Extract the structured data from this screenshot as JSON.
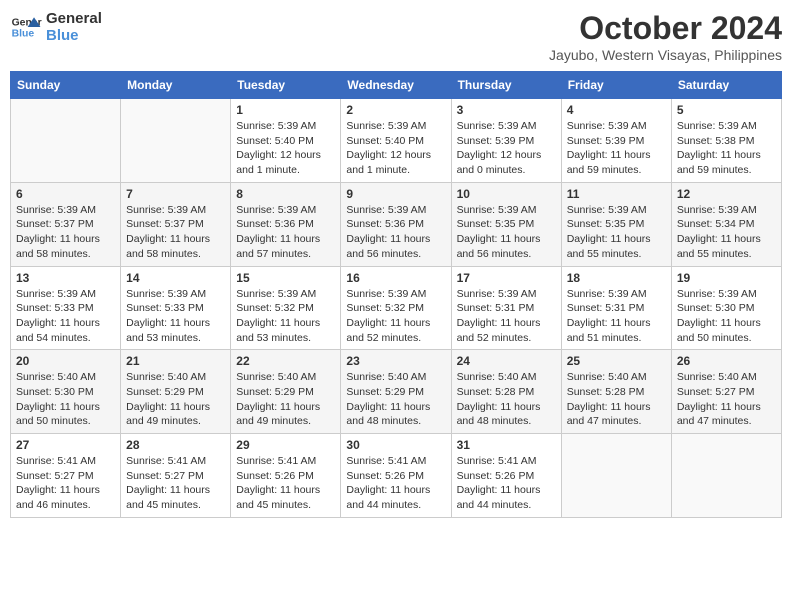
{
  "logo": {
    "line1": "General",
    "line2": "Blue"
  },
  "title": "October 2024",
  "location": "Jayubo, Western Visayas, Philippines",
  "days_header": [
    "Sunday",
    "Monday",
    "Tuesday",
    "Wednesday",
    "Thursday",
    "Friday",
    "Saturday"
  ],
  "weeks": [
    [
      {
        "day": "",
        "info": ""
      },
      {
        "day": "",
        "info": ""
      },
      {
        "day": "1",
        "info": "Sunrise: 5:39 AM\nSunset: 5:40 PM\nDaylight: 12 hours\nand 1 minute."
      },
      {
        "day": "2",
        "info": "Sunrise: 5:39 AM\nSunset: 5:40 PM\nDaylight: 12 hours\nand 1 minute."
      },
      {
        "day": "3",
        "info": "Sunrise: 5:39 AM\nSunset: 5:39 PM\nDaylight: 12 hours\nand 0 minutes."
      },
      {
        "day": "4",
        "info": "Sunrise: 5:39 AM\nSunset: 5:39 PM\nDaylight: 11 hours\nand 59 minutes."
      },
      {
        "day": "5",
        "info": "Sunrise: 5:39 AM\nSunset: 5:38 PM\nDaylight: 11 hours\nand 59 minutes."
      }
    ],
    [
      {
        "day": "6",
        "info": "Sunrise: 5:39 AM\nSunset: 5:37 PM\nDaylight: 11 hours\nand 58 minutes."
      },
      {
        "day": "7",
        "info": "Sunrise: 5:39 AM\nSunset: 5:37 PM\nDaylight: 11 hours\nand 58 minutes."
      },
      {
        "day": "8",
        "info": "Sunrise: 5:39 AM\nSunset: 5:36 PM\nDaylight: 11 hours\nand 57 minutes."
      },
      {
        "day": "9",
        "info": "Sunrise: 5:39 AM\nSunset: 5:36 PM\nDaylight: 11 hours\nand 56 minutes."
      },
      {
        "day": "10",
        "info": "Sunrise: 5:39 AM\nSunset: 5:35 PM\nDaylight: 11 hours\nand 56 minutes."
      },
      {
        "day": "11",
        "info": "Sunrise: 5:39 AM\nSunset: 5:35 PM\nDaylight: 11 hours\nand 55 minutes."
      },
      {
        "day": "12",
        "info": "Sunrise: 5:39 AM\nSunset: 5:34 PM\nDaylight: 11 hours\nand 55 minutes."
      }
    ],
    [
      {
        "day": "13",
        "info": "Sunrise: 5:39 AM\nSunset: 5:33 PM\nDaylight: 11 hours\nand 54 minutes."
      },
      {
        "day": "14",
        "info": "Sunrise: 5:39 AM\nSunset: 5:33 PM\nDaylight: 11 hours\nand 53 minutes."
      },
      {
        "day": "15",
        "info": "Sunrise: 5:39 AM\nSunset: 5:32 PM\nDaylight: 11 hours\nand 53 minutes."
      },
      {
        "day": "16",
        "info": "Sunrise: 5:39 AM\nSunset: 5:32 PM\nDaylight: 11 hours\nand 52 minutes."
      },
      {
        "day": "17",
        "info": "Sunrise: 5:39 AM\nSunset: 5:31 PM\nDaylight: 11 hours\nand 52 minutes."
      },
      {
        "day": "18",
        "info": "Sunrise: 5:39 AM\nSunset: 5:31 PM\nDaylight: 11 hours\nand 51 minutes."
      },
      {
        "day": "19",
        "info": "Sunrise: 5:39 AM\nSunset: 5:30 PM\nDaylight: 11 hours\nand 50 minutes."
      }
    ],
    [
      {
        "day": "20",
        "info": "Sunrise: 5:40 AM\nSunset: 5:30 PM\nDaylight: 11 hours\nand 50 minutes."
      },
      {
        "day": "21",
        "info": "Sunrise: 5:40 AM\nSunset: 5:29 PM\nDaylight: 11 hours\nand 49 minutes."
      },
      {
        "day": "22",
        "info": "Sunrise: 5:40 AM\nSunset: 5:29 PM\nDaylight: 11 hours\nand 49 minutes."
      },
      {
        "day": "23",
        "info": "Sunrise: 5:40 AM\nSunset: 5:29 PM\nDaylight: 11 hours\nand 48 minutes."
      },
      {
        "day": "24",
        "info": "Sunrise: 5:40 AM\nSunset: 5:28 PM\nDaylight: 11 hours\nand 48 minutes."
      },
      {
        "day": "25",
        "info": "Sunrise: 5:40 AM\nSunset: 5:28 PM\nDaylight: 11 hours\nand 47 minutes."
      },
      {
        "day": "26",
        "info": "Sunrise: 5:40 AM\nSunset: 5:27 PM\nDaylight: 11 hours\nand 47 minutes."
      }
    ],
    [
      {
        "day": "27",
        "info": "Sunrise: 5:41 AM\nSunset: 5:27 PM\nDaylight: 11 hours\nand 46 minutes."
      },
      {
        "day": "28",
        "info": "Sunrise: 5:41 AM\nSunset: 5:27 PM\nDaylight: 11 hours\nand 45 minutes."
      },
      {
        "day": "29",
        "info": "Sunrise: 5:41 AM\nSunset: 5:26 PM\nDaylight: 11 hours\nand 45 minutes."
      },
      {
        "day": "30",
        "info": "Sunrise: 5:41 AM\nSunset: 5:26 PM\nDaylight: 11 hours\nand 44 minutes."
      },
      {
        "day": "31",
        "info": "Sunrise: 5:41 AM\nSunset: 5:26 PM\nDaylight: 11 hours\nand 44 minutes."
      },
      {
        "day": "",
        "info": ""
      },
      {
        "day": "",
        "info": ""
      }
    ]
  ]
}
